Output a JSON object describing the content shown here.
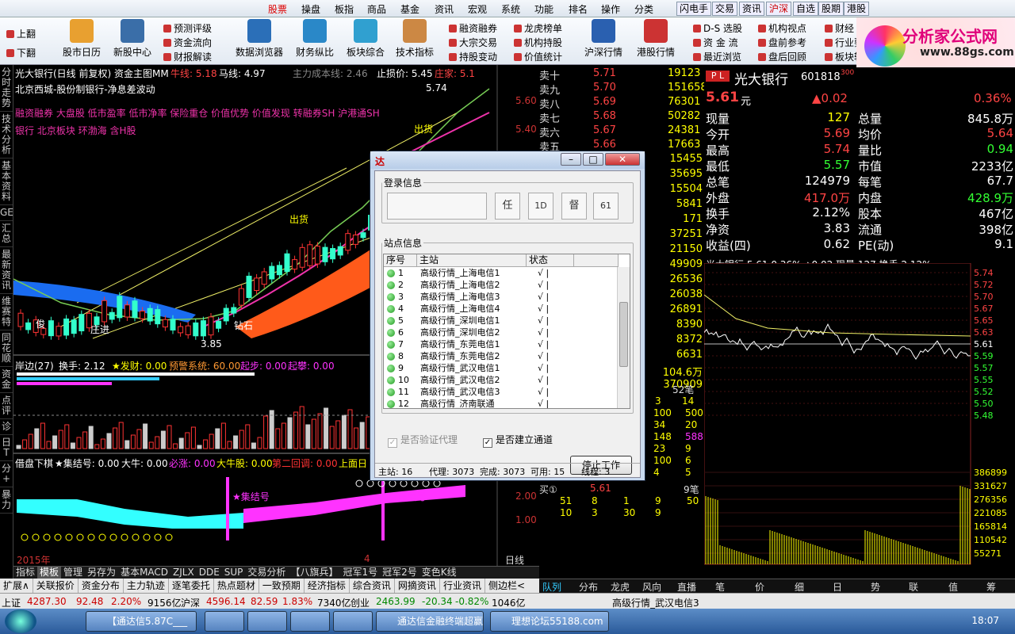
{
  "menubar": {
    "items": [
      "股票",
      "操盘",
      "板指",
      "商品",
      "基金",
      "资讯",
      "宏观",
      "系统",
      "功能",
      "排名",
      "操作",
      "分类"
    ],
    "tags": [
      "闪电手",
      "交易",
      "资讯",
      "沪深",
      "自选",
      "股期",
      "港股"
    ]
  },
  "toolbar": {
    "left": [
      "上翻",
      "下翻"
    ],
    "big": [
      "股市日历",
      "新股中心",
      "数据浏览器",
      "财务纵比",
      "板块综合",
      "技术指标",
      "沪深行情",
      "港股行情"
    ],
    "small": [
      "预测评级",
      "资金流向",
      "财报解读",
      "融资融券",
      "大宗交易",
      "持股变动",
      "龙虎榜单",
      "机构持股",
      "价值统计",
      "D-S 选股",
      "资 金 流",
      "最近浏览",
      "机构视点",
      "盘前参考",
      "盘后回顾",
      "财经",
      "行业要闻",
      "板块轮动",
      "期 权"
    ],
    "logo_title": "分析家公式网",
    "logo_url": "www.88gs.com"
  },
  "leftnav": [
    "分时走势",
    "技术分析",
    "基本资料",
    "GET",
    "汇总",
    "最新资讯",
    "维赛特",
    "同花顺",
    "资金",
    "点评",
    "诊",
    "日T",
    "分+",
    "暴力"
  ],
  "chart": {
    "header": "光大银行(日线 前复权) 资金主图MM",
    "ma_labels": [
      "牛线: 5.18",
      "马线: 4.97",
      "主力成本线: 2.46",
      "止损价: 5.45",
      "庄家: 5.1"
    ],
    "subtitle": "北京西城-股份制银行-净息差波动",
    "concepts1": "融资融券 大盘股 低市盈率 低市净率 保险重仓 价值优势 价值发现 转融券SH 沪港通SH",
    "concepts2": "银行 北京板块 环渤海 含H股",
    "price_labels": [
      "5.60",
      "5.40"
    ],
    "annotations": {
      "high": "5.74",
      "low": "3.85",
      "chu": "出货",
      "zhuang": "庄进",
      "zuan": "钻石",
      "jun": "俊",
      "chu2": "出货"
    },
    "ind1": {
      "name": "岸边(27)",
      "huanshou": "换手: 2.12",
      "facai": "★发财: 0.00",
      "yujing": "预警系统: 60.00",
      "qibu": "起步: 0.00",
      "qipan": "起攀: 0.00"
    },
    "ind2": {
      "name": "借盘下棋",
      "jijie": "★集结号: 0.00",
      "daniu": "大牛: 0.00",
      "bizhang": "必涨: 0.00",
      "daniuyu": "大牛股: 0.00",
      "dierhui": "第二回调: 0.00",
      "shangmian": "上面日"
    },
    "ind2_labels": [
      "★集结号",
      "★集结号"
    ],
    "ind2_axis": [
      "2.00",
      "1.00"
    ],
    "date_labels": [
      "2015年",
      "4"
    ],
    "right_label": "日线"
  },
  "bottom_tabs1": [
    "指标",
    "模板",
    "管理",
    "另存为",
    "基本MACD",
    "ZJLX",
    "DDE",
    "SUP",
    "交易分析",
    "【八旗兵】",
    "冠军1号",
    "冠军2号",
    "变色K线"
  ],
  "bottom_tabs2": [
    "扩展∧",
    "关联报价",
    "资金分布",
    "主力轨迹",
    "逐笔委托",
    "热点题材",
    "一致预期",
    "经济指标",
    "综合资讯",
    "网摘资讯",
    "行业资讯"
  ],
  "bottom_tabs2_extra": "侧边栏<",
  "orderbook": {
    "sells": [
      {
        "l": "卖十",
        "p": "5.71",
        "v": "19123"
      },
      {
        "l": "卖九",
        "p": "5.70",
        "v": "151658"
      },
      {
        "l": "卖八",
        "p": "5.69",
        "v": "76301"
      },
      {
        "l": "卖七",
        "p": "5.68",
        "v": "50282"
      },
      {
        "l": "卖六",
        "p": "5.67",
        "v": "24381"
      },
      {
        "l": "卖五",
        "p": "5.66",
        "v": "17663"
      }
    ],
    "right_vols": [
      "15455",
      "35695",
      "15504",
      "5841",
      "171",
      "37251",
      "21150",
      "49909",
      "26536",
      "26038",
      "26891",
      "8390",
      "8372",
      "6631",
      "104.6万",
      "370909"
    ],
    "bi": "52笔",
    "rows": [
      [
        "",
        "3",
        "14"
      ],
      [
        "100",
        "500"
      ],
      [
        "34",
        "20"
      ],
      [
        "148",
        "588"
      ],
      [
        "23",
        "9"
      ],
      [
        "100",
        "6"
      ],
      [
        "4",
        "5"
      ]
    ],
    "buy1": "买①",
    "buy1p": "5.61",
    "buy1v": "9笔",
    "buyrows": [
      [
        "51",
        "8",
        "1",
        "9",
        "50"
      ],
      [
        "10",
        "3",
        "30",
        "9"
      ]
    ]
  },
  "quote": {
    "name": "光大银行",
    "code": "601818",
    "code_sub": "300",
    "price": "5.61",
    "unit": "元",
    "change": "▲0.02",
    "pct": "0.36%",
    "rows": [
      [
        "现量",
        "127",
        "总量",
        "845.8万"
      ],
      [
        "今开",
        "5.69",
        "均价",
        "5.64"
      ],
      [
        "最高",
        "5.74",
        "量比",
        "0.94"
      ],
      [
        "最低",
        "5.57",
        "市值",
        "2233亿"
      ],
      [
        "总笔",
        "124979",
        "每笔",
        "67.7"
      ],
      [
        "外盘",
        "417.0万",
        "内盘",
        "428.9万"
      ],
      [
        "换手",
        "2.12%",
        "股本",
        "467亿"
      ],
      [
        "净资",
        "3.83",
        "流通",
        "398亿"
      ],
      [
        "收益(四)",
        "0.62",
        "PE(动)",
        "9.1"
      ]
    ],
    "mini_header": "光大银行  5.61  0.36%  ▲0.02  现量 127  换手 2.12%",
    "mini_axis": [
      "5.74",
      "5.72",
      "5.70",
      "5.67",
      "5.65",
      "5.63",
      "5.61",
      "5.59",
      "5.57",
      "5.55",
      "5.52",
      "5.50",
      "5.48"
    ],
    "vol_axis": [
      "386899",
      "331627",
      "276356",
      "221085",
      "165814",
      "110542",
      "55271"
    ]
  },
  "right_tabs": [
    "队列",
    "分布",
    "龙虎",
    "风向",
    "直播",
    "笔",
    "价",
    "细",
    "日",
    "势",
    "联",
    "值",
    "筹"
  ],
  "statusbar": {
    "sh_label": "上证",
    "sh_val": "4287.30",
    "sh_chg": "92.48",
    "sh_pct": "2.20%",
    "sh_amt": "9156亿",
    "hs_label": "沪深",
    "hs_val": "4596.14",
    "hs_chg": "82.59",
    "hs_pct": "1.83%",
    "hs_amt": "7340亿",
    "cy_label": "创业",
    "cy_val": "2463.99",
    "cy_chg": "-20.34",
    "cy_pct": "-0.82%",
    "cy_amt": "1046亿",
    "server": "高级行情_武汉电信3"
  },
  "taskbar": {
    "items": [
      "【通达信5.87C___",
      "",
      "",
      "",
      "",
      "通达信金融终端超赢...",
      "理想论坛55188.com"
    ],
    "time": "18:07"
  },
  "dialog": {
    "login_title": "登录信息",
    "login_buttons": [
      "任",
      "1D",
      "督",
      "61"
    ],
    "site_title": "站点信息",
    "headers": [
      "序号",
      "主站",
      "状态"
    ],
    "sites": [
      {
        "n": "1",
        "name": "高级行情_上海电信1",
        "s": "√ |"
      },
      {
        "n": "2",
        "name": "高级行情_上海电信2",
        "s": "√ |"
      },
      {
        "n": "3",
        "name": "高级行情_上海电信3",
        "s": "√ |"
      },
      {
        "n": "4",
        "name": "高级行情_上海电信4",
        "s": "√ |"
      },
      {
        "n": "5",
        "name": "高级行情_深圳电信1",
        "s": "√ |"
      },
      {
        "n": "6",
        "name": "高级行情_深圳电信2",
        "s": "√ |"
      },
      {
        "n": "7",
        "name": "高级行情_东莞电信1",
        "s": "√ |"
      },
      {
        "n": "8",
        "name": "高级行情_东莞电信2",
        "s": "√ |"
      },
      {
        "n": "9",
        "name": "高级行情_武汉电信1",
        "s": "√ |"
      },
      {
        "n": "10",
        "name": "高级行情_武汉电信2",
        "s": "√ |"
      },
      {
        "n": "11",
        "name": "高级行情_武汉电信3",
        "s": "√ |"
      },
      {
        "n": "12",
        "name": "高级行情_济南联通",
        "s": "√ |"
      }
    ],
    "proxy": "是否验证代理",
    "channel": "是否建立通道",
    "stop": "停止工作",
    "status": {
      "main": "主站: 16",
      "proxy": "代理: 3073",
      "done": "完成: 3073",
      "avail": "可用: 15",
      "thread": "线程: 3"
    }
  }
}
